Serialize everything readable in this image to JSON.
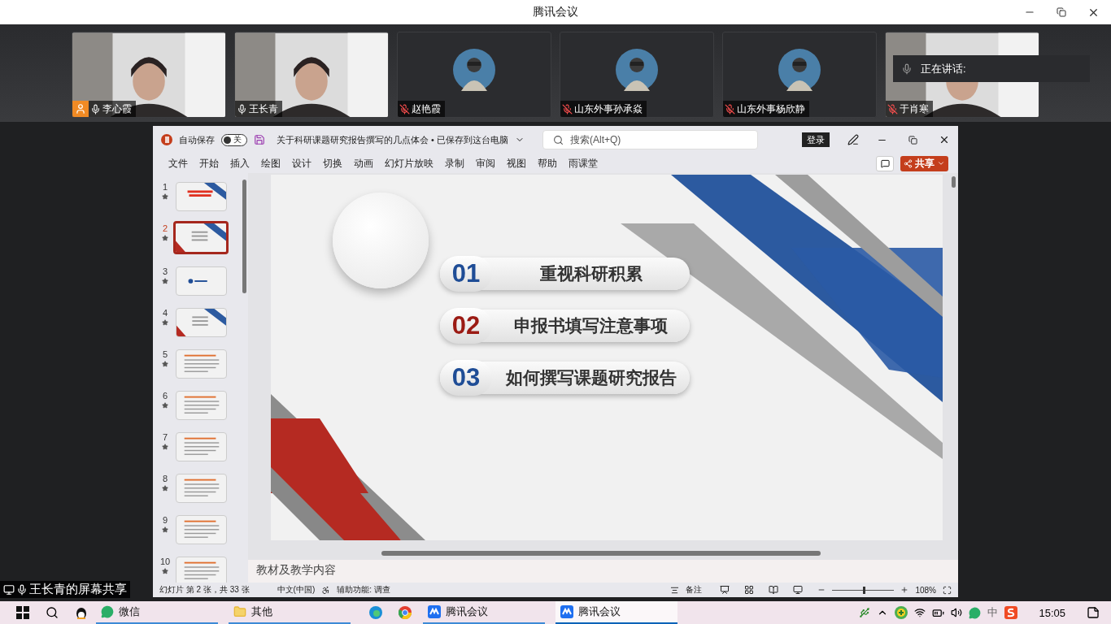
{
  "meeting": {
    "title": "腾讯会议"
  },
  "participants": [
    {
      "name": "李心霞",
      "kind": "video",
      "muted": false,
      "host": true
    },
    {
      "name": "王长青",
      "kind": "video",
      "muted": false,
      "host": false
    },
    {
      "name": "赵艳霞",
      "kind": "avatar",
      "muted": true,
      "host": false
    },
    {
      "name": "山东外事孙承焱",
      "kind": "avatar",
      "muted": true,
      "host": false
    },
    {
      "name": "山东外事杨欣静",
      "kind": "avatar",
      "muted": true,
      "host": false
    },
    {
      "name": "于肖寒",
      "kind": "video",
      "muted": true,
      "host": false
    }
  ],
  "speaking": {
    "label": "正在讲话:"
  },
  "screen_share": {
    "label": "王长青的屏幕共享"
  },
  "ppt": {
    "autosave_label": "自动保存",
    "autosave_on": false,
    "autosave_state": "关",
    "doc_title": "关于科研课题研究报告撰写的几点体会 • 已保存到这台电脑",
    "search_placeholder": "搜索(Alt+Q)",
    "login": "登录",
    "share": "共享",
    "menu": [
      "文件",
      "开始",
      "插入",
      "绘图",
      "设计",
      "切换",
      "动画",
      "幻灯片放映",
      "录制",
      "审阅",
      "视图",
      "帮助",
      "雨课堂"
    ],
    "slides": [
      {
        "number": "1",
        "kind": "title",
        "selected": false
      },
      {
        "number": "2",
        "kind": "stripes",
        "selected": true
      },
      {
        "number": "3",
        "kind": "section",
        "selected": false
      },
      {
        "number": "4",
        "kind": "stripes",
        "selected": false
      },
      {
        "number": "5",
        "kind": "text",
        "selected": false
      },
      {
        "number": "6",
        "kind": "text",
        "selected": false
      },
      {
        "number": "7",
        "kind": "text",
        "selected": false
      },
      {
        "number": "8",
        "kind": "text",
        "selected": false
      },
      {
        "number": "9",
        "kind": "text",
        "selected": false
      },
      {
        "number": "10",
        "kind": "text",
        "selected": false
      }
    ],
    "slide_items": [
      {
        "number": "01",
        "text": "重视科研积累",
        "color": "#1f4d96"
      },
      {
        "number": "02",
        "text": "申报书填写注意事项",
        "color": "#9b1b14"
      },
      {
        "number": "03",
        "text": "如何撰写课题研究报告",
        "color": "#1f4d96"
      }
    ],
    "notes": "教材及教学内容",
    "status": {
      "slide_info": "幻灯片 第 2 张，共 33 张",
      "language": "中文(中国)",
      "accessibility": "辅助功能: 调查",
      "notes_button": "备注",
      "zoom": "108%",
      "zoom_slider": {
        "level": 0.5
      }
    }
  },
  "taskbar": {
    "apps": [
      {
        "label": "微信",
        "kind": "wechat",
        "active": false
      },
      {
        "label": "其他",
        "kind": "folder",
        "active": false
      },
      {
        "label": "腾讯会议",
        "kind": "meeting",
        "active": false
      },
      {
        "label": "腾讯会议",
        "kind": "meeting",
        "active": true
      }
    ],
    "ime": "中",
    "time": "15:05"
  }
}
